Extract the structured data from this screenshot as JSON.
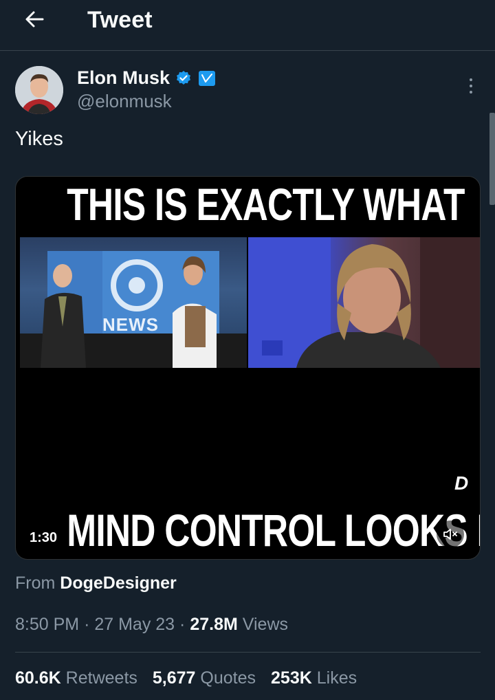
{
  "header": {
    "title": "Tweet",
    "back_icon": "arrow-left-icon"
  },
  "author": {
    "name": "Elon Musk",
    "handle": "@elonmusk",
    "verified_color": "#1d9bf0"
  },
  "tweet": {
    "text": "Yikes"
  },
  "media": {
    "caption_top": "THIS IS EXACTLY WHAT",
    "caption_bottom": "MIND CONTROL LOOKS LIKE",
    "news_logo_text": "NEWS",
    "duration": "1:30",
    "watermark": "D",
    "mute_icon": "speaker-muted-icon"
  },
  "source": {
    "prefix": "From",
    "name": "DogeDesigner"
  },
  "meta": {
    "time": "8:50 PM",
    "sep1": "·",
    "date": "27 May 23",
    "sep2": "·",
    "views_count": "27.8M",
    "views_label": "Views"
  },
  "stats": {
    "retweets_count": "60.6K",
    "retweets_label": "Retweets",
    "quotes_count": "5,677",
    "quotes_label": "Quotes",
    "likes_count": "253K",
    "likes_label": "Likes"
  },
  "colors": {
    "background": "#15202b",
    "text_primary": "#f7f9f9",
    "text_secondary": "#8b98a5",
    "accent": "#1d9bf0"
  }
}
